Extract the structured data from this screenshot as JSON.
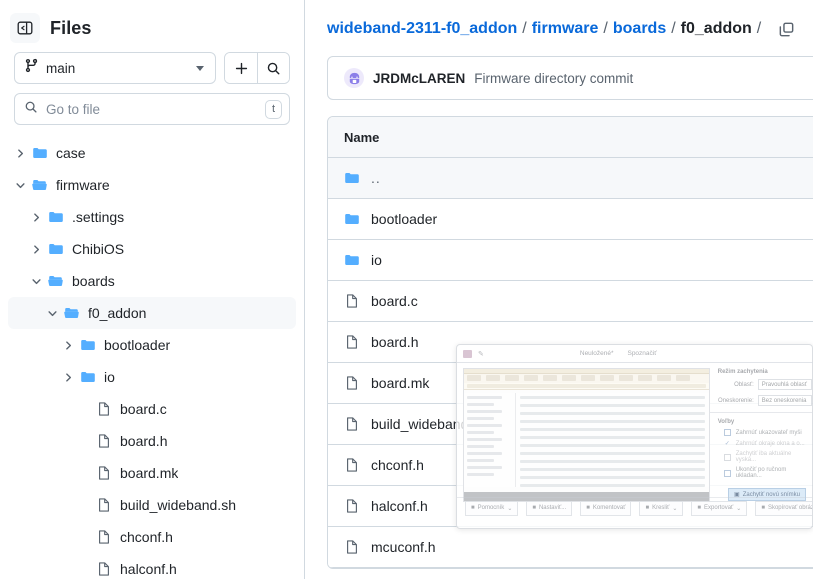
{
  "sidebar": {
    "panel_toggle_icon": "sidebar-collapse-icon",
    "title": "Files",
    "branch": {
      "icon": "git-branch-icon",
      "name": "main",
      "add_label": "+",
      "add_icon": "plus-icon",
      "search_icon": "search-icon"
    },
    "search": {
      "icon": "search-icon",
      "placeholder": "Go to file",
      "value": "",
      "shortcut": "t"
    },
    "tree": [
      {
        "label": "case",
        "type": "folder",
        "depth": 0,
        "expanded": false,
        "selected": false
      },
      {
        "label": "firmware",
        "type": "folder-open",
        "depth": 0,
        "expanded": true,
        "selected": false
      },
      {
        "label": ".settings",
        "type": "folder",
        "depth": 1,
        "expanded": false,
        "selected": false
      },
      {
        "label": "ChibiOS",
        "type": "folder",
        "depth": 1,
        "expanded": false,
        "selected": false
      },
      {
        "label": "boards",
        "type": "folder-open",
        "depth": 1,
        "expanded": true,
        "selected": false
      },
      {
        "label": "f0_addon",
        "type": "folder-open",
        "depth": 2,
        "expanded": true,
        "selected": true
      },
      {
        "label": "bootloader",
        "type": "folder",
        "depth": 3,
        "expanded": false,
        "selected": false
      },
      {
        "label": "io",
        "type": "folder",
        "depth": 3,
        "expanded": false,
        "selected": false
      },
      {
        "label": "board.c",
        "type": "file",
        "depth": 4,
        "expanded": null,
        "selected": false
      },
      {
        "label": "board.h",
        "type": "file",
        "depth": 4,
        "expanded": null,
        "selected": false
      },
      {
        "label": "board.mk",
        "type": "file",
        "depth": 4,
        "expanded": null,
        "selected": false
      },
      {
        "label": "build_wideband.sh",
        "type": "file",
        "depth": 4,
        "expanded": null,
        "selected": false
      },
      {
        "label": "chconf.h",
        "type": "file",
        "depth": 4,
        "expanded": null,
        "selected": false
      },
      {
        "label": "halconf.h",
        "type": "file",
        "depth": 4,
        "expanded": null,
        "selected": false
      }
    ]
  },
  "main": {
    "breadcrumb": {
      "repo": "wideband-2311-f0_addon",
      "parts": [
        "firmware",
        "boards"
      ],
      "current": "f0_addon",
      "separator": "/",
      "copy_icon": "copy-path-icon"
    },
    "commit": {
      "avatar_icon": "user-avatar",
      "author": "JRDMcLAREN",
      "message": "Firmware directory commit"
    },
    "table": {
      "columns": [
        "Name"
      ],
      "rows": [
        {
          "name": "..",
          "type": "up"
        },
        {
          "name": "bootloader",
          "type": "folder"
        },
        {
          "name": "io",
          "type": "folder"
        },
        {
          "name": "board.c",
          "type": "file"
        },
        {
          "name": "board.h",
          "type": "file"
        },
        {
          "name": "board.mk",
          "type": "file"
        },
        {
          "name": "build_wideband.sh",
          "type": "file"
        },
        {
          "name": "chconf.h",
          "type": "file"
        },
        {
          "name": "halconf.h",
          "type": "file"
        },
        {
          "name": "mcuconf.h",
          "type": "file"
        }
      ]
    }
  },
  "overlay": {
    "window_icon": "snipping-tool-icon",
    "pin_icon": "pin-icon",
    "tabs": [
      "Neuložené*",
      "Spoznačiť"
    ],
    "sections": {
      "capture_mode": "Režim zachytenia",
      "options": "Voľby"
    },
    "fields": [
      {
        "label": "Oblasť:",
        "value": "Pravouhlá oblasť"
      },
      {
        "label": "Oneskorenie:",
        "value": "Bez oneskorenia"
      }
    ],
    "checkboxes": [
      {
        "label": "Zahrnúť ukazovateľ myši",
        "checked": false,
        "dim": false
      },
      {
        "label": "Zahrnúť okraje okna a o...",
        "checked": true,
        "dim": true
      },
      {
        "label": "Zachytiť iba aktuálne vyska...",
        "checked": false,
        "dim": true
      },
      {
        "label": "Ukončiť po ručnom ukladan...",
        "checked": false,
        "dim": false
      }
    ],
    "capture_button": "Zachytiť novú snímku",
    "toolbar": [
      {
        "label": "Pomocník",
        "icon": "help-icon",
        "caret": true
      },
      {
        "label": "Nastaviť...",
        "icon": "settings-icon",
        "caret": false
      },
      {
        "label": "Komentovať",
        "icon": "pen-icon",
        "caret": false
      },
      {
        "label": "Kresliť",
        "icon": "draw-icon",
        "caret": true
      },
      {
        "label": "Exportovať",
        "icon": "share-icon",
        "caret": true
      },
      {
        "label": "Skopírovať obrázok do schránky",
        "icon": "copy-icon",
        "caret": false
      }
    ]
  },
  "colors": {
    "link": "#0969da",
    "folder": "#54aeff",
    "border": "#d1d9e0",
    "muted": "#59636e",
    "surface": "#f6f8fa"
  }
}
